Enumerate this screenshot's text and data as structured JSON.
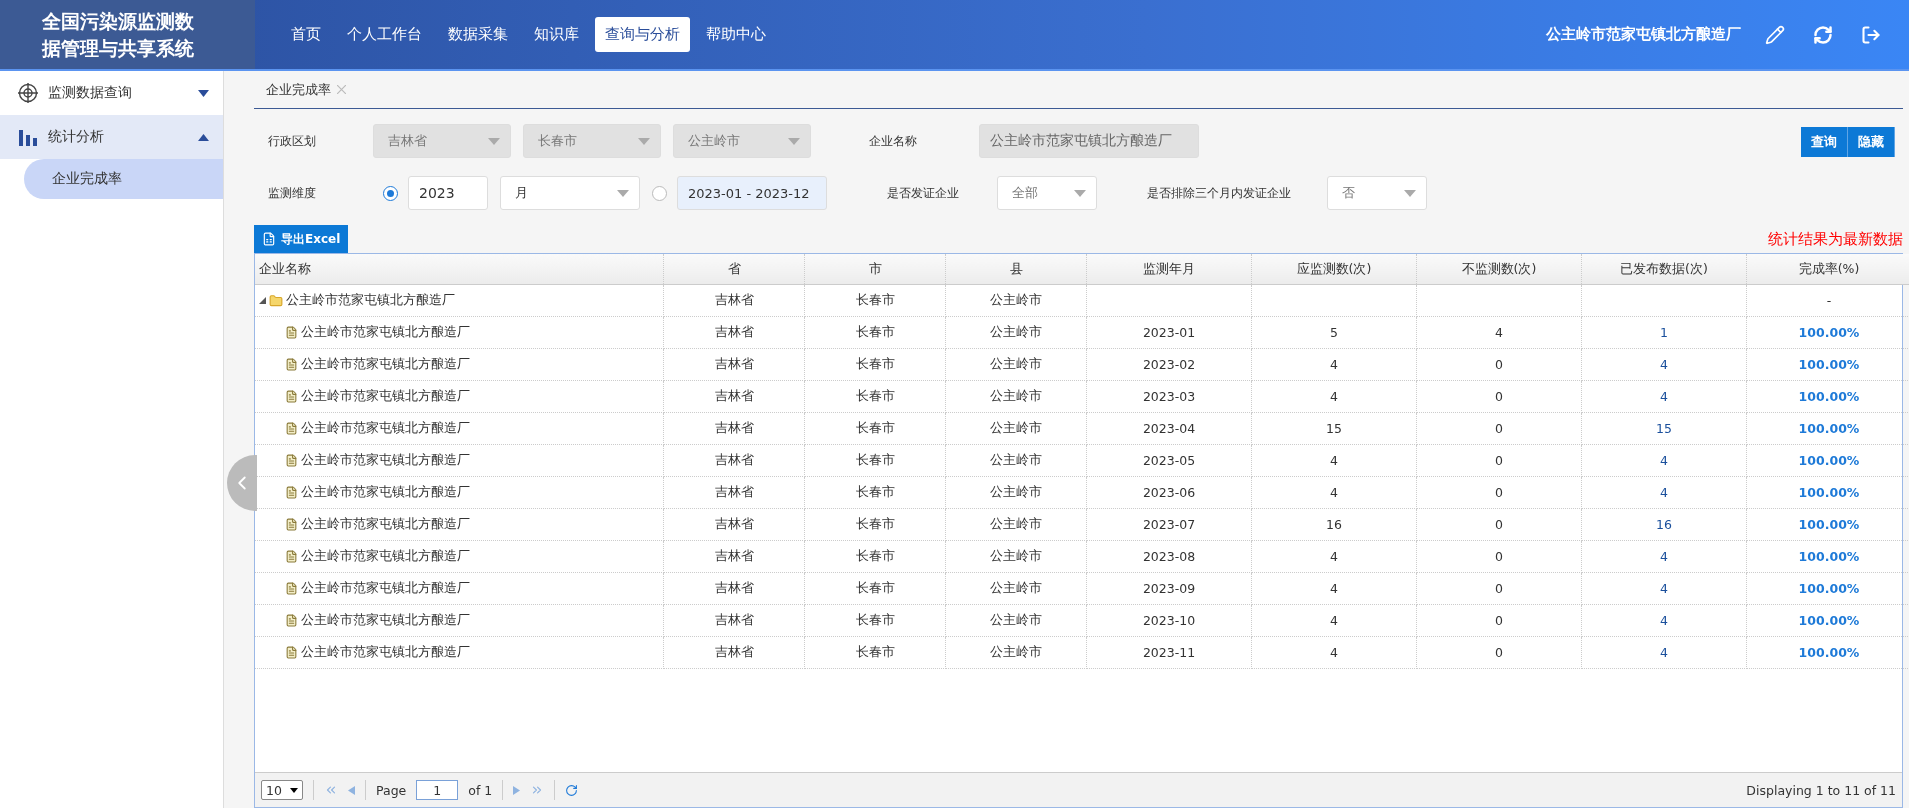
{
  "header": {
    "title_lines": [
      "全国污染源监测数",
      "据管理与共享系统"
    ],
    "nav": [
      {
        "label": "首页",
        "selected": false
      },
      {
        "label": "个人工作台",
        "selected": false
      },
      {
        "label": "数据采集",
        "selected": false
      },
      {
        "label": "知识库",
        "selected": false
      },
      {
        "label": "查询与分析",
        "selected": true
      },
      {
        "label": "帮助中心",
        "selected": false
      }
    ],
    "user": "公主岭市范家屯镇北方酿造厂"
  },
  "sidebar": {
    "items": [
      {
        "label": "监测数据查询",
        "kind": "target",
        "expanded": false
      },
      {
        "label": "统计分析",
        "kind": "chart",
        "expanded": true,
        "children": [
          {
            "label": "企业完成率",
            "selected": true
          }
        ]
      }
    ]
  },
  "tabs": [
    {
      "label": "企业完成率",
      "selected": true
    }
  ],
  "filters": {
    "region_label": "行政区划",
    "region": [
      "吉林省",
      "长春市",
      "公主岭市"
    ],
    "company_label": "企业名称",
    "company": "公主岭市范家屯镇北方酿造厂",
    "dimension_label": "监测维度",
    "year_selected": true,
    "year": "2023",
    "period": "月",
    "range": "2023-01 - 2023-12",
    "licensed_label": "是否发证企业",
    "licensed": "全部",
    "exclude_label": "是否排除三个月内发证企业",
    "exclude": "否",
    "buttons": [
      "查询",
      "隐藏"
    ]
  },
  "export_button": "导出Excel",
  "notice": "统计结果为最新数据",
  "table": {
    "columns": [
      "企业名称",
      "省",
      "市",
      "县",
      "监测年月",
      "应监测数(次)",
      "不监测数(次)",
      "已发布数据(次)",
      "完成率(%)"
    ],
    "groups": [
      {
        "cells": [
          "公主岭市范家屯镇北方酿造厂",
          "吉林省",
          "长春市",
          "公主岭市",
          "",
          "",
          "",
          "",
          "-"
        ],
        "expanded": true,
        "rows": [
          [
            "公主岭市范家屯镇北方酿造厂",
            "吉林省",
            "长春市",
            "公主岭市",
            "2023-01",
            "5",
            "4",
            "1",
            "100.00%"
          ],
          [
            "公主岭市范家屯镇北方酿造厂",
            "吉林省",
            "长春市",
            "公主岭市",
            "2023-02",
            "4",
            "0",
            "4",
            "100.00%"
          ],
          [
            "公主岭市范家屯镇北方酿造厂",
            "吉林省",
            "长春市",
            "公主岭市",
            "2023-03",
            "4",
            "0",
            "4",
            "100.00%"
          ],
          [
            "公主岭市范家屯镇北方酿造厂",
            "吉林省",
            "长春市",
            "公主岭市",
            "2023-04",
            "15",
            "0",
            "15",
            "100.00%"
          ],
          [
            "公主岭市范家屯镇北方酿造厂",
            "吉林省",
            "长春市",
            "公主岭市",
            "2023-05",
            "4",
            "0",
            "4",
            "100.00%"
          ],
          [
            "公主岭市范家屯镇北方酿造厂",
            "吉林省",
            "长春市",
            "公主岭市",
            "2023-06",
            "4",
            "0",
            "4",
            "100.00%"
          ],
          [
            "公主岭市范家屯镇北方酿造厂",
            "吉林省",
            "长春市",
            "公主岭市",
            "2023-07",
            "16",
            "0",
            "16",
            "100.00%"
          ],
          [
            "公主岭市范家屯镇北方酿造厂",
            "吉林省",
            "长春市",
            "公主岭市",
            "2023-08",
            "4",
            "0",
            "4",
            "100.00%"
          ],
          [
            "公主岭市范家屯镇北方酿造厂",
            "吉林省",
            "长春市",
            "公主岭市",
            "2023-09",
            "4",
            "0",
            "4",
            "100.00%"
          ],
          [
            "公主岭市范家屯镇北方酿造厂",
            "吉林省",
            "长春市",
            "公主岭市",
            "2023-10",
            "4",
            "0",
            "4",
            "100.00%"
          ],
          [
            "公主岭市范家屯镇北方酿造厂",
            "吉林省",
            "长春市",
            "公主岭市",
            "2023-11",
            "4",
            "0",
            "4",
            "100.00%"
          ]
        ]
      }
    ]
  },
  "pagination": {
    "page_size": "10",
    "page_label": "Page",
    "page": "1",
    "of": "of 1",
    "display": "Displaying 1 to 11 of 11"
  }
}
